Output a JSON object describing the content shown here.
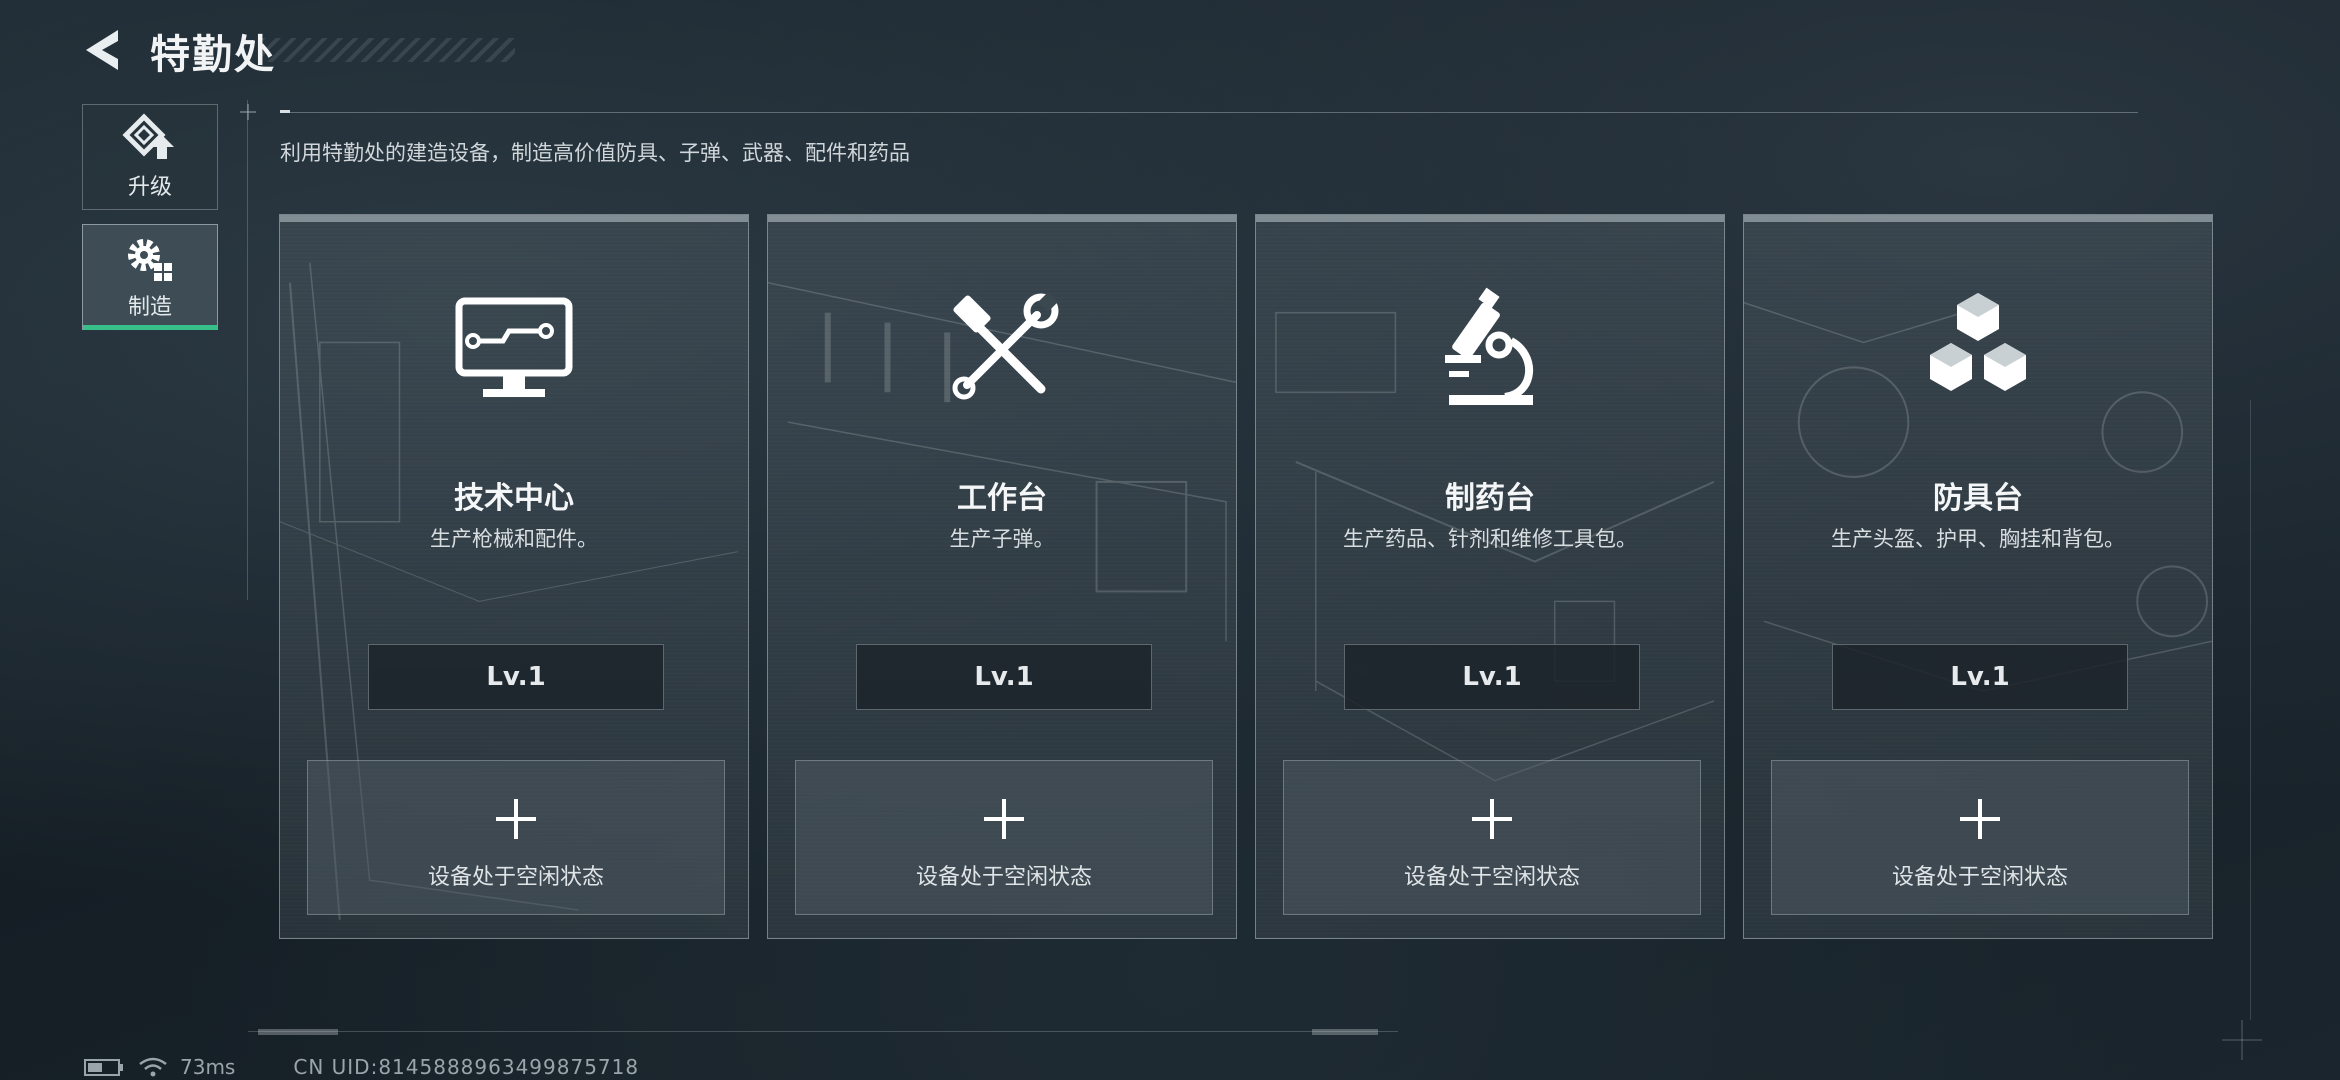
{
  "header": {
    "title": "特勤处",
    "back_icon": "back-arrow-icon"
  },
  "sidebar": {
    "items": [
      {
        "label": "升级",
        "icon": "upgrade-icon",
        "active": false
      },
      {
        "label": "制造",
        "icon": "craft-gear-icon",
        "active": true
      }
    ],
    "active_color": "#38c08a"
  },
  "description": "利用特勤处的建造设备，制造高价值防具、子弹、武器、配件和药品",
  "stations": [
    {
      "title": "技术中心",
      "subtitle": "生产枪械和配件。",
      "level": "Lv.1",
      "status": "设备处于空闲状态",
      "icon": "computer-icon"
    },
    {
      "title": "工作台",
      "subtitle": "生产子弹。",
      "level": "Lv.1",
      "status": "设备处于空闲状态",
      "icon": "hammer-wrench-icon"
    },
    {
      "title": "制药台",
      "subtitle": "生产药品、针剂和维修工具包。",
      "level": "Lv.1",
      "status": "设备处于空闲状态",
      "icon": "microscope-icon"
    },
    {
      "title": "防具台",
      "subtitle": "生产头盔、护甲、胸挂和背包。",
      "level": "Lv.1",
      "status": "设备处于空闲状态",
      "icon": "cubes-icon"
    }
  ],
  "status_bar": {
    "ping": "73ms",
    "uid": "CN UID:8145888963499875718"
  }
}
